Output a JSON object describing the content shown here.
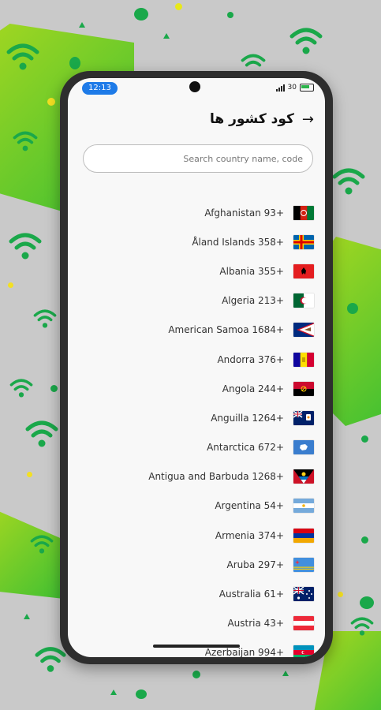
{
  "status_bar": {
    "time": "12:13",
    "battery": "30"
  },
  "header": {
    "title": "کود کشور ها",
    "back_icon": "arrow-right-icon"
  },
  "search": {
    "placeholder": "Search country name, code",
    "value": ""
  },
  "countries": [
    {
      "label": "Afghanistan 93+",
      "flag": "af"
    },
    {
      "label": "Åland Islands 358+",
      "flag": "ax"
    },
    {
      "label": "Albania 355+",
      "flag": "al"
    },
    {
      "label": "Algeria 213+",
      "flag": "dz"
    },
    {
      "label": "American Samoa 1684+",
      "flag": "as"
    },
    {
      "label": "Andorra 376+",
      "flag": "ad"
    },
    {
      "label": "Angola 244+",
      "flag": "ao"
    },
    {
      "label": "Anguilla 1264+",
      "flag": "ai"
    },
    {
      "label": "Antarctica 672+",
      "flag": "aq"
    },
    {
      "label": "Antigua and Barbuda 1268+",
      "flag": "ag"
    },
    {
      "label": "Argentina 54+",
      "flag": "ar"
    },
    {
      "label": "Armenia 374+",
      "flag": "am"
    },
    {
      "label": "Aruba 297+",
      "flag": "aw"
    },
    {
      "label": "Australia 61+",
      "flag": "au"
    },
    {
      "label": "Austria 43+",
      "flag": "at"
    },
    {
      "label": "Azerbaijan 994+",
      "flag": "az"
    }
  ],
  "colors": {
    "accent": "#1e7be8",
    "background_green": "#3cbf33",
    "background_gray": "#c9c9c9"
  }
}
